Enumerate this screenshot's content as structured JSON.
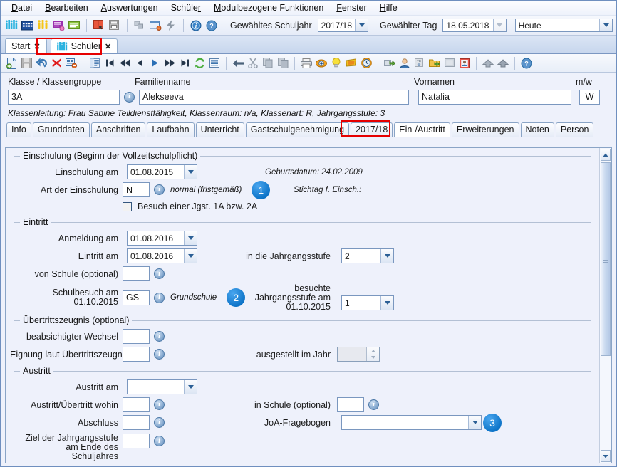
{
  "menu": {
    "items": [
      "Datei",
      "Bearbeiten",
      "Auswertungen",
      "Schüler",
      "Modulbezogene Funktionen",
      "Fenster",
      "Hilfe"
    ]
  },
  "toolbar_main": {
    "schoolyear_label": "Gewähltes Schuljahr",
    "schoolyear_value": "2017/18",
    "day_label": "Gewählter Tag",
    "day_value": "18.05.2018",
    "today_value": "Heute",
    "icons": [
      "students-group-icon",
      "school-building-icon",
      "persons-icon",
      "message-purple-icon",
      "message-green-icon",
      "report-book-icon",
      "printer-report-icon",
      "modules-icon",
      "window-close-icon",
      "lightning-icon",
      "info-icon",
      "help-icon"
    ]
  },
  "window_tabs": [
    {
      "label": "Start",
      "close": "✕",
      "icon": ""
    },
    {
      "label": "Schüler",
      "close": "✕",
      "icon": "students-group-icon"
    }
  ],
  "toolbar_record": {
    "icons": [
      "new-record-icon",
      "save-icon",
      "undo-icon",
      "delete-icon",
      "cancel-edit-icon",
      "list-view-icon",
      "first-record-icon",
      "fast-back-icon",
      "prev-record-icon",
      "next-record-icon",
      "fast-forward-icon",
      "last-record-icon",
      "refresh-icon",
      "list-icon",
      "back-arrow-icon",
      "cut-icon",
      "copy-icon",
      "paste-icon",
      "print-icon",
      "preview-icon",
      "idea-icon",
      "filter-icon",
      "clock-icon",
      "export-icon",
      "person-icon",
      "tb-icon",
      "folder-export-icon",
      "note-icon",
      "photo-icon",
      "up-merge-icon",
      "up-merge2-icon",
      "help-icon"
    ]
  },
  "header": {
    "class_label": "Klasse / Klassengruppe",
    "class_value": "3A",
    "lastname_label": "Familienname",
    "lastname_value": "Alekseeva",
    "firstname_label": "Vornamen",
    "firstname_value": "Natalia",
    "gender_label": "m/w",
    "gender_value": "W",
    "class_note": "Klassenleitung: Frau Sabine Teildienstfähigkeit, Klassenraum: n/a, Klassenart: R, Jahrgangsstufe: 3"
  },
  "inner_tabs": [
    {
      "label": "Info",
      "active": false
    },
    {
      "label": "Grunddaten",
      "active": false
    },
    {
      "label": "Anschriften",
      "active": false
    },
    {
      "label": "Laufbahn",
      "active": false
    },
    {
      "label": "Unterricht",
      "active": false
    },
    {
      "label": "Gastschulgenehmigung",
      "active": false
    },
    {
      "label": "2017/18",
      "active": false
    },
    {
      "label": "Ein-/Austritt",
      "active": true
    },
    {
      "label": "Erweiterungen",
      "active": false
    },
    {
      "label": "Noten",
      "active": false
    },
    {
      "label": "Person",
      "active": false
    }
  ],
  "form": {
    "einschulung": {
      "title": "Einschulung (Beginn der Vollzeitschulpflicht)",
      "date_label": "Einschulung am",
      "date_value": "01.08.2015",
      "art_label": "Art der Einschulung",
      "art_value": "N",
      "art_desc": "normal (fristgemäß)",
      "badge": "1",
      "birthdate_text": "Geburtsdatum: 24.02.2009",
      "stichtag_text": "Stichtag f. Einsch.:",
      "checkbox_label": "Besuch einer Jgst. 1A bzw. 2A",
      "checkbox_checked": false
    },
    "eintritt": {
      "title": "Eintritt",
      "anmeldung_label": "Anmeldung am",
      "anmeldung_value": "01.08.2016",
      "eintritt_label": "Eintritt am",
      "eintritt_value": "01.08.2016",
      "jahrgangsstufe_label": "in die Jahrgangsstufe",
      "jahrgangsstufe_value": "2",
      "vonschule_label": "von Schule (optional)",
      "vonschule_value": "",
      "schulbesuch_label_1": "Schulbesuch am",
      "schulbesuch_label_2": "01.10.2015",
      "schulbesuch_value": "GS",
      "schulbesuch_desc": "Grundschule",
      "badge": "2",
      "besuchte_label_1": "besuchte",
      "besuchte_label_2": "Jahrgangsstufe am",
      "besuchte_label_3": "01.10.2015",
      "besuchte_value": "1"
    },
    "uebertritt": {
      "title": "Übertrittszeugnis (optional)",
      "wechsel_label": "beabsichtigter Wechsel",
      "wechsel_value": "",
      "eignung_label": "Eignung laut Übertrittszeugnis",
      "eignung_value": "",
      "jahr_label": "ausgestellt im Jahr",
      "jahr_value": ""
    },
    "austritt": {
      "title": "Austritt",
      "austritt_label": "Austritt am",
      "austritt_value": "",
      "wohin_label": "Austritt/Übertritt wohin",
      "wohin_value": "",
      "inschule_label": "in Schule (optional)",
      "inschule_value": "",
      "abschluss_label": "Abschluss",
      "abschluss_value": "",
      "joa_label": "JoA-Fragebogen",
      "joa_value": "",
      "badge": "3",
      "ziel_label_1": "Ziel der Jahrgangsstufe",
      "ziel_label_2": "am Ende des",
      "ziel_label_3": "Schuljahres",
      "ziel_value": ""
    }
  },
  "colors": {
    "accent_blue": "#0b72c6",
    "highlight_red": "#e60000",
    "panel_bg": "#eef1fb"
  }
}
